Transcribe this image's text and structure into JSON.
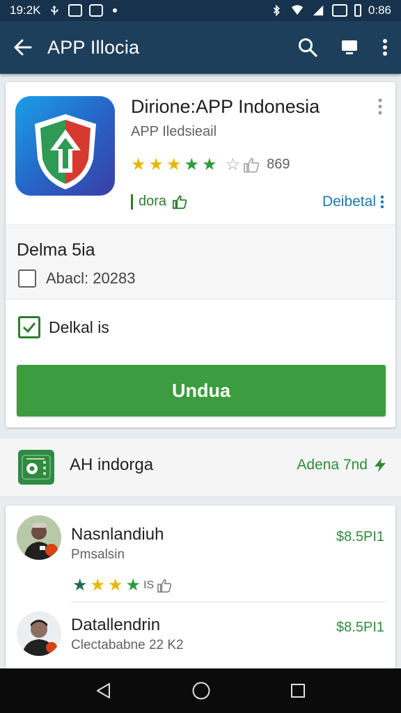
{
  "status_bar": {
    "time": "19:2K",
    "right_time": "0:86",
    "icons": [
      "usb-icon",
      "image-icon",
      "app-icon",
      "dot-icon",
      "bluetooth-icon",
      "wifi-icon",
      "signal-icon",
      "nfc-icon",
      "battery-icon"
    ]
  },
  "app_bar": {
    "title": "APP Illocia",
    "icons": [
      "back-arrow-icon",
      "search-icon",
      "cast-icon",
      "more-vert-icon"
    ]
  },
  "app": {
    "name": "Dirione:APP Indonesia",
    "developer": "APP Iledsieail",
    "rating_count": "869",
    "tag": "dora",
    "detail_link": "Deibetal",
    "stars": 5,
    "accent": "#3c9c3f"
  },
  "options": {
    "section_title": "Delma 5ia",
    "option1_label": "Abacl: 20283",
    "option1_checked": false,
    "option2_label": "Delkal is",
    "option2_checked": true,
    "install_label": "Undua"
  },
  "related": {
    "title": "AH indorga",
    "link": "Adena 7nd"
  },
  "reviews": [
    {
      "name": "Nasnlandiuh",
      "subtitle": "Pmsalsin",
      "price": "$8.5PI1",
      "rating_text": "IS"
    },
    {
      "name": "Datallendrin",
      "subtitle": "Clectababne 22 K2",
      "price": "$8.5PI1"
    }
  ],
  "nav_bar": {
    "icons": [
      "nav-back-icon",
      "nav-home-icon",
      "nav-recents-icon"
    ]
  }
}
